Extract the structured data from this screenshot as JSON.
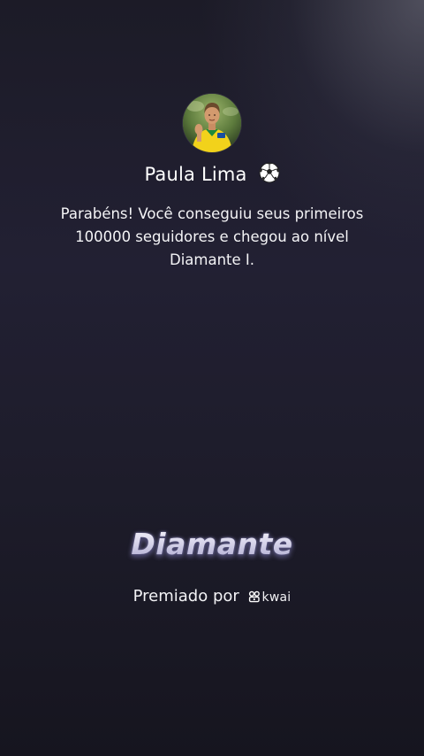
{
  "profile": {
    "avatar_icon": "user-avatar-photo",
    "name": "Paula Lima",
    "name_emoji": "soccer-ball-icon"
  },
  "achievement": {
    "message": "Parabéns! Você conseguiu seus primeiros 100000 seguidores e chegou ao nível Diamante I.",
    "level_title": "Diamante"
  },
  "footer": {
    "awarded_by_label": "Premiado por",
    "brand_icon": "kwai-logo-icon",
    "brand_name": "kwai"
  },
  "colors": {
    "background_top": "#1c1b27",
    "background_bottom": "#16151f",
    "text": "#ffffff",
    "level_gradient_light": "#ffffff",
    "level_gradient_dark": "#9f9cc6"
  }
}
